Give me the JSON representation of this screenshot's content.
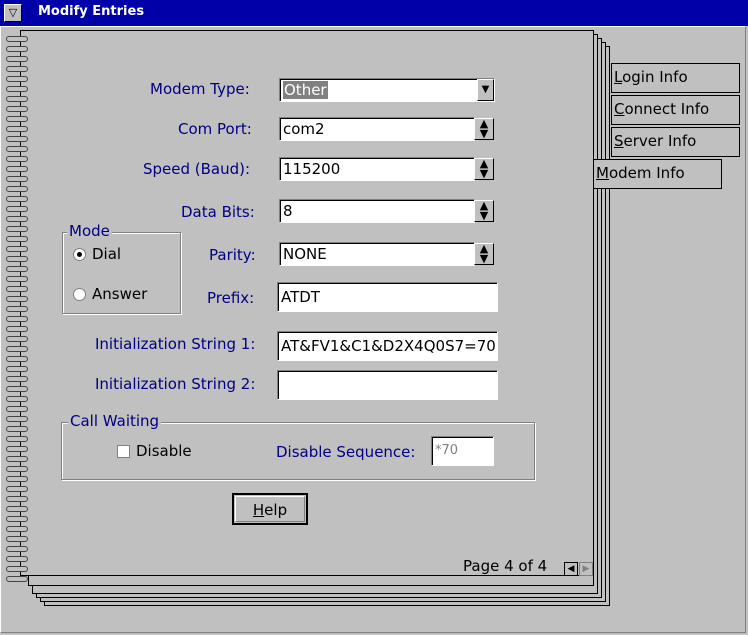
{
  "window": {
    "title": "Modify Entries"
  },
  "form": {
    "modem_type": {
      "label": "Modem Type:",
      "value": "Other"
    },
    "com_port": {
      "label": "Com Port:",
      "value": "com2"
    },
    "speed": {
      "label": "Speed (Baud):",
      "value": "115200"
    },
    "data_bits": {
      "label": "Data Bits:",
      "value": "8"
    },
    "parity": {
      "label": "Parity:",
      "value": "NONE"
    },
    "prefix": {
      "label": "Prefix:",
      "value": "ATDT"
    },
    "init1": {
      "label": "Initialization String 1:",
      "value": "AT&FV1&C1&D2X4Q0S7=70"
    },
    "init2": {
      "label": "Initialization String 2:",
      "value": ""
    }
  },
  "mode": {
    "title": "Mode",
    "dial": "Dial",
    "answer": "Answer",
    "selected": "Dial"
  },
  "call_waiting": {
    "title": "Call Waiting",
    "disable_label": "Disable",
    "disable_checked": false,
    "sequence_label": "Disable Sequence:",
    "sequence_value": "*70"
  },
  "buttons": {
    "help": "Help",
    "help_mnemonic": "H",
    "help_rest": "elp"
  },
  "tabs": [
    {
      "label": "Login Info",
      "mnemonic": "L",
      "rest": "ogin Info"
    },
    {
      "label": "Connect Info",
      "mnemonic": "C",
      "rest": "onnect Info"
    },
    {
      "label": "Server Info",
      "mnemonic": "S",
      "rest": "erver Info"
    },
    {
      "label": "Modem Info",
      "mnemonic": "M",
      "rest": "odem Info",
      "active": true
    }
  ],
  "pager": {
    "text": "Page 4 of 4"
  }
}
